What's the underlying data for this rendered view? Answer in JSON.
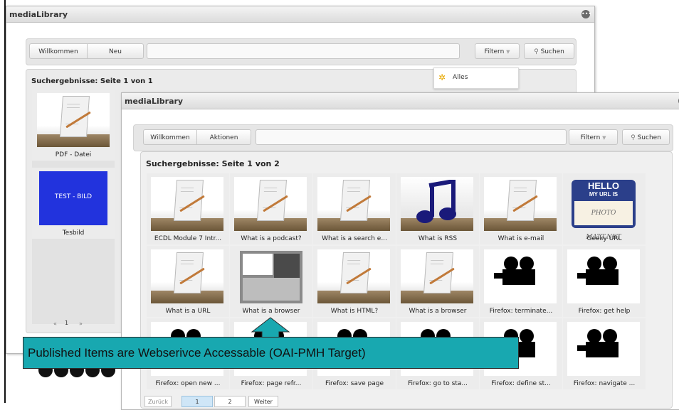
{
  "back_window": {
    "title": "mediaLibrary",
    "toolbar": {
      "welcome": "Willkommen",
      "new": "Neu",
      "filter": "Filtern",
      "search": "Suchen"
    },
    "filter_menu": {
      "item_all": "Alles"
    },
    "results_title": "Suchergebnisse: Seite 1 von 1",
    "tiles": [
      {
        "label": "PDF - Datei"
      },
      {
        "label": "Tesbild",
        "image_text": "TEST - BILD"
      }
    ],
    "pager": {
      "prev": "«",
      "page": "1",
      "next": "»"
    }
  },
  "front_window": {
    "title": "mediaLibrary",
    "toolbar": {
      "welcome": "Willkommen",
      "actions": "Aktionen",
      "filter": "Filtern",
      "search": "Suchen"
    },
    "results_title": "Suchergebnisse: Seite 1 von 2",
    "rows": [
      [
        {
          "label": "ECDL Module 7 Intr...",
          "icon": "document-pencil"
        },
        {
          "label": "What is a podcast?",
          "icon": "document-pencil"
        },
        {
          "label": "What is a search e...",
          "icon": "document-pencil"
        },
        {
          "label": "What is RSS",
          "icon": "music-note"
        },
        {
          "label": "What is e-mail",
          "icon": "document-pencil"
        },
        {
          "label": "Geeky URL",
          "icon": "name-tag",
          "tag_line1": "HELLO",
          "tag_line2": "MY URL IS",
          "tag_line3": "PHOTO MATT.NET"
        }
      ],
      [
        {
          "label": "What is a URL",
          "icon": "document-pencil"
        },
        {
          "label": "What is a browser",
          "icon": "screenshot"
        },
        {
          "label": "What is HTML?",
          "icon": "document-pencil"
        },
        {
          "label": "What is a browser",
          "icon": "document-pencil"
        },
        {
          "label": "Firefox: terminate...",
          "icon": "video-camera"
        },
        {
          "label": "Firefox: get help",
          "icon": "video-camera"
        }
      ],
      [
        {
          "label": "Firefox: open new ...",
          "icon": "video-camera"
        },
        {
          "label": "Firefox: page refr...",
          "icon": "video-camera"
        },
        {
          "label": "Firefox: save page",
          "icon": "video-camera"
        },
        {
          "label": "Firefox: go to sta...",
          "icon": "video-camera"
        },
        {
          "label": "Firefox: define st...",
          "icon": "video-camera"
        },
        {
          "label": "Firefox: navigate ...",
          "icon": "video-camera"
        }
      ]
    ],
    "pager": {
      "prev": "Zurück",
      "page1": "1",
      "page2": "2",
      "next": "Weiter"
    }
  },
  "callout": {
    "text": "Published Items are Webserivce Accessable (OAI-PMH Target)"
  },
  "colors": {
    "callout": "#18a8b0",
    "test_image": "#2233dd"
  }
}
